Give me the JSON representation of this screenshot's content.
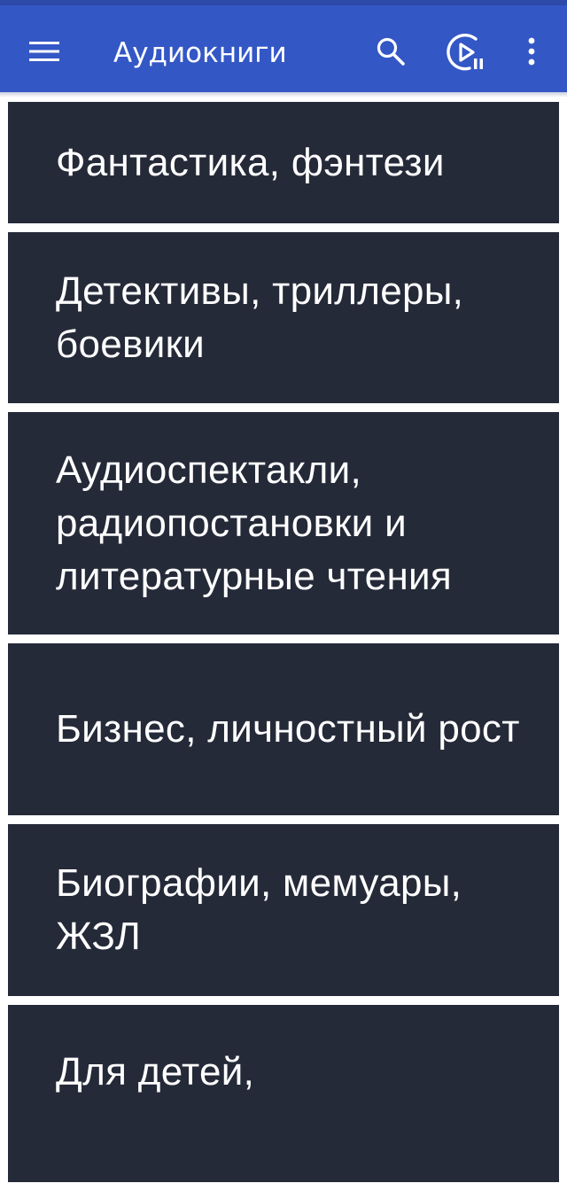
{
  "app_bar": {
    "title": "Аудиокниги",
    "background": "#3457c6",
    "icons": [
      "menu-icon",
      "search-icon",
      "player-icon",
      "more-vertical-icon"
    ]
  },
  "categories": [
    {
      "label": "Фантастика, фэнтези"
    },
    {
      "label": "Детективы, триллеры, боевики"
    },
    {
      "label": "Аудиоспектакли, радиопостановки и литературные чтения"
    },
    {
      "label": "Бизнес, личностный рост"
    },
    {
      "label": "Биографии, мемуары, ЖЗЛ"
    },
    {
      "label": "Для детей,"
    }
  ],
  "colors": {
    "card_background": "#252a39",
    "card_text": "#ffffff",
    "page_background": "#ffffff"
  }
}
